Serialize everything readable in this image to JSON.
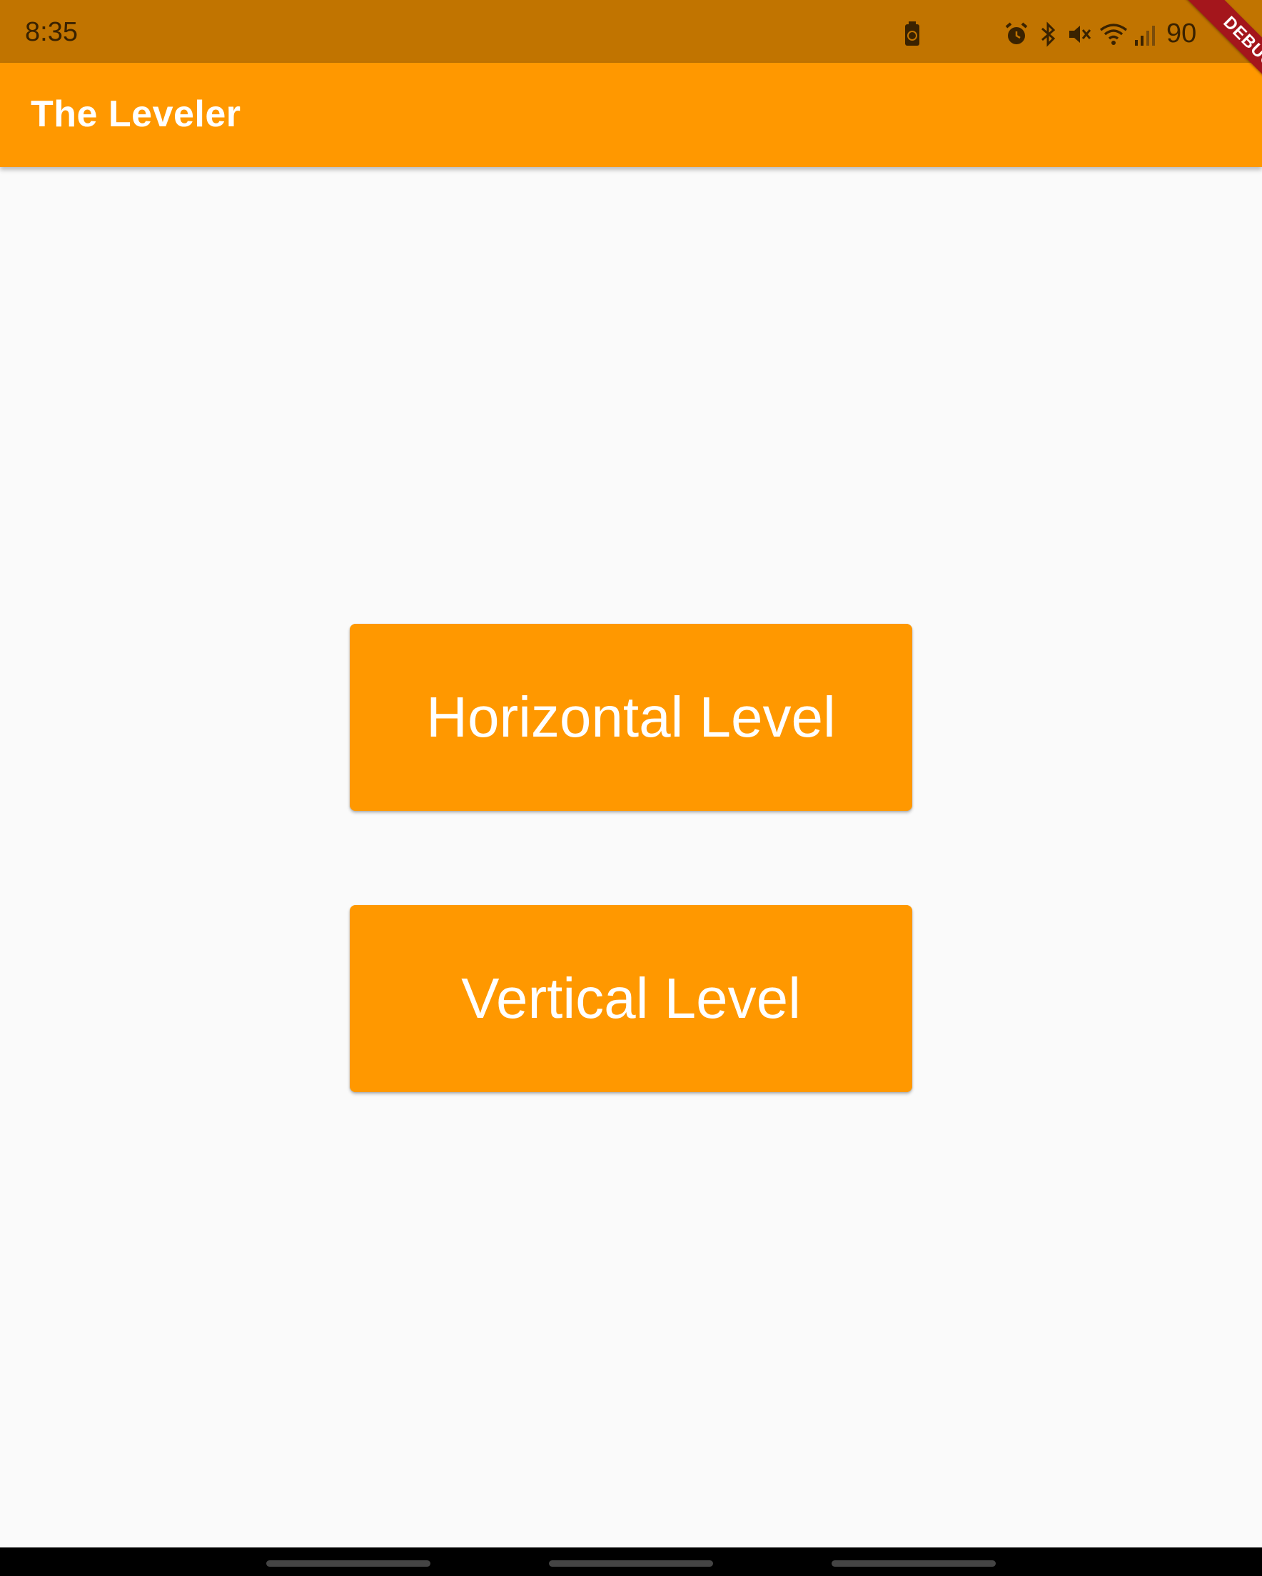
{
  "status_bar": {
    "time": "8:35",
    "battery_text": "90",
    "icons": [
      "battery-saver-icon",
      "alarm-icon",
      "bluetooth-icon",
      "mute-icon",
      "wifi-icon",
      "signal-icon"
    ],
    "color": "#c17400"
  },
  "app_bar": {
    "title": "The Leveler",
    "color": "#ff9800"
  },
  "debug_banner": {
    "label": "DEBUG"
  },
  "buttons": {
    "horizontal_label": "Horizontal Level",
    "vertical_label": "Vertical Level",
    "color": "#ff9800"
  },
  "nav_bar": {
    "handles": [
      "nav-handle-left",
      "nav-handle-center",
      "nav-handle-right"
    ]
  }
}
